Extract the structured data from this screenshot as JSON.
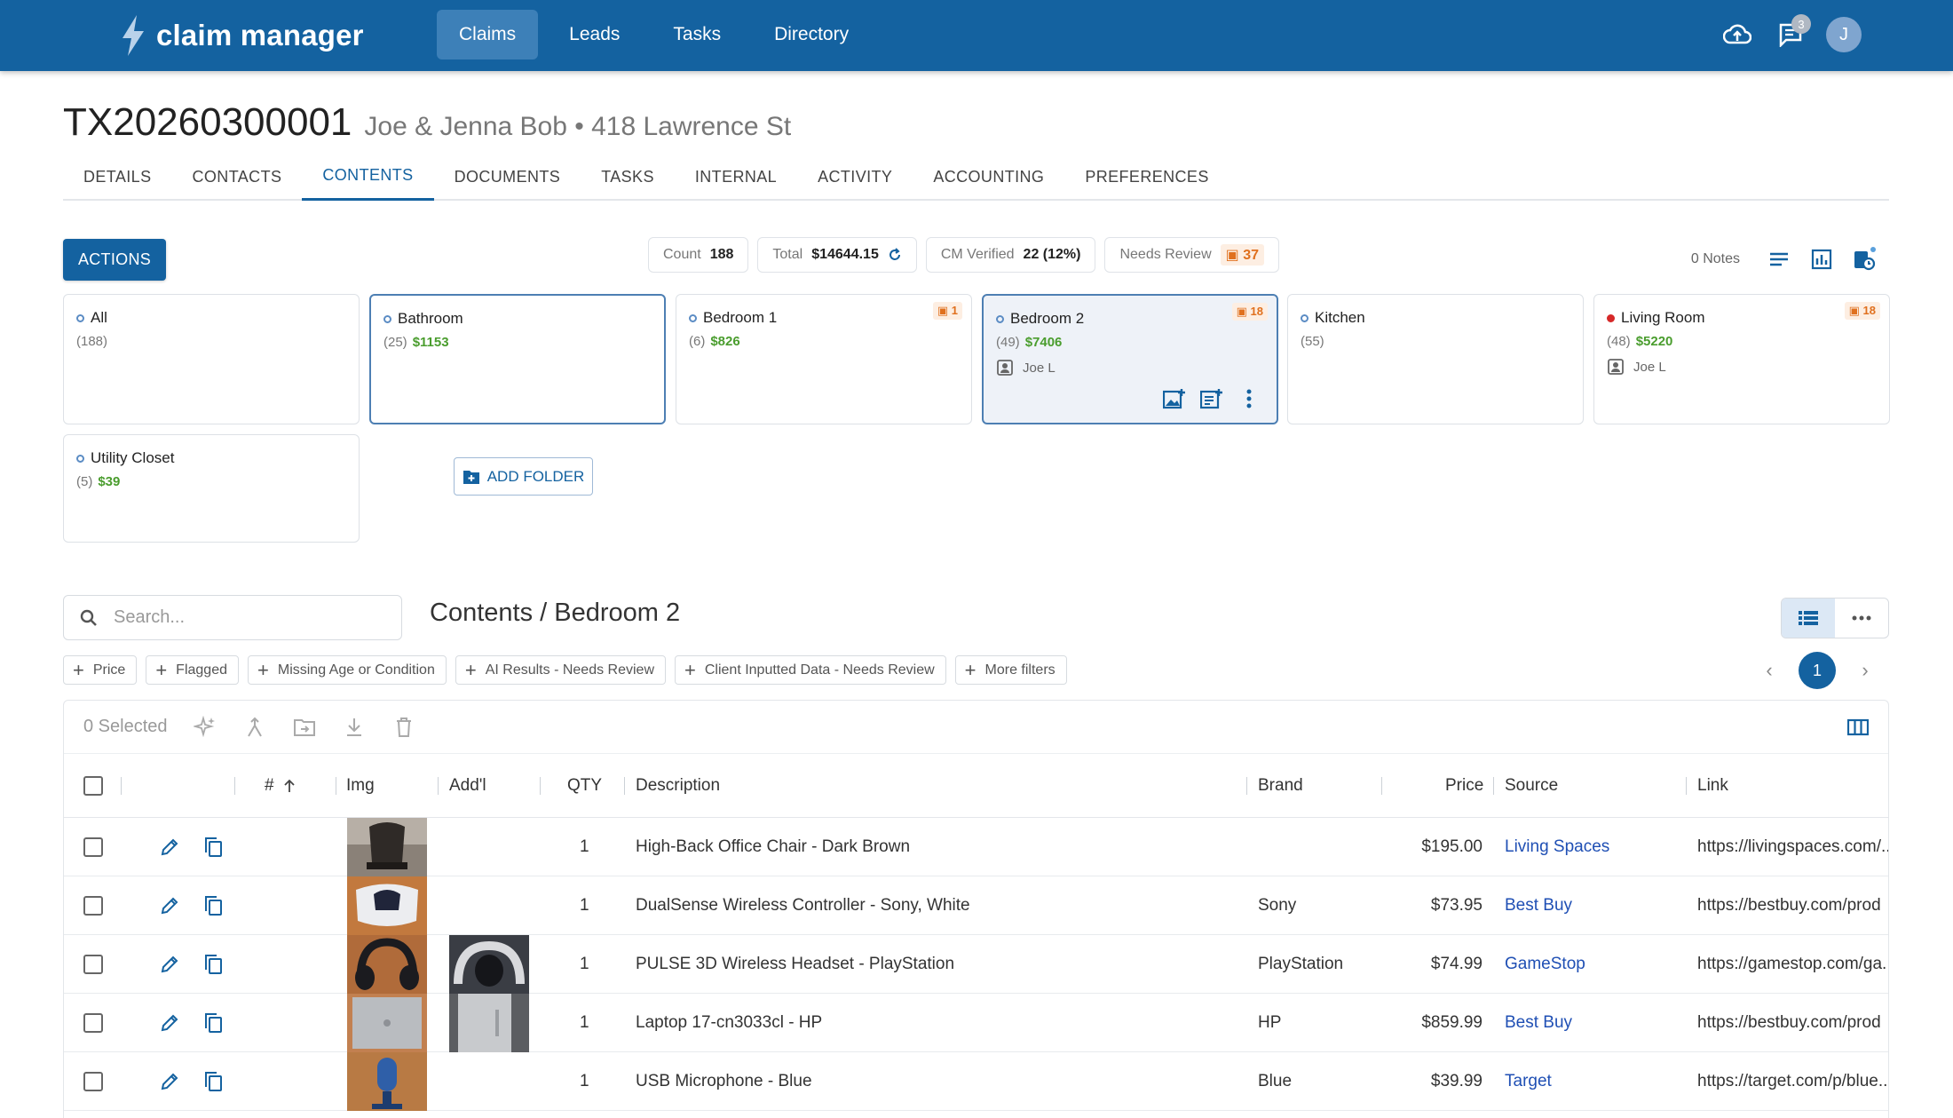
{
  "app": {
    "name": "claim manager",
    "nav": [
      "Claims",
      "Leads",
      "Tasks",
      "Directory"
    ],
    "notification_count": "3",
    "avatar_initial": "J",
    "accent": "#1462a0"
  },
  "claim": {
    "id": "TX20260300001",
    "subtitle": "Joe & Jenna Bob • 418 Lawrence St"
  },
  "tabs": [
    "DETAILS",
    "CONTACTS",
    "CONTENTS",
    "DOCUMENTS",
    "TASKS",
    "INTERNAL",
    "ACTIVITY",
    "ACCOUNTING",
    "PREFERENCES"
  ],
  "actions_label": "ACTIONS",
  "stats": {
    "count_label": "Count",
    "count_value": "188",
    "total_label": "Total",
    "total_value": "$14644.15",
    "verified_label": "CM Verified",
    "verified_value": "22 (12%)",
    "review_label": "Needs Review",
    "review_value": "37"
  },
  "notes_label": "0 Notes",
  "folders": [
    {
      "name": "All",
      "count": "(188)",
      "amount": "",
      "user": "",
      "flag": ""
    },
    {
      "name": "Bathroom",
      "count": "(25)",
      "amount": "$1153",
      "user": "",
      "flag": ""
    },
    {
      "name": "Bedroom 1",
      "count": "(6)",
      "amount": "$826",
      "user": "",
      "flag": "1"
    },
    {
      "name": "Bedroom 2",
      "count": "(49)",
      "amount": "$7406",
      "user": "Joe L",
      "flag": "18"
    },
    {
      "name": "Kitchen",
      "count": "(55)",
      "amount": "",
      "user": "",
      "flag": ""
    },
    {
      "name": "Living Room",
      "count": "(48)",
      "amount": "$5220",
      "user": "Joe L",
      "flag": "18"
    },
    {
      "name": "Utility Closet",
      "count": "(5)",
      "amount": "$39",
      "user": "",
      "flag": ""
    }
  ],
  "add_folder_label": "ADD FOLDER",
  "search": {
    "placeholder": "Search..."
  },
  "contents_title": "Contents / Bedroom 2",
  "filters": [
    "Price",
    "Flagged",
    "Missing Age or Condition",
    "AI Results - Needs Review",
    "Client Inputted Data - Needs Review",
    "More filters"
  ],
  "page": "1",
  "selected_label": "0 Selected",
  "columns": {
    "num": "#",
    "img": "Img",
    "addl": "Add'l",
    "qty": "QTY",
    "description": "Description",
    "brand": "Brand",
    "price": "Price",
    "source": "Source",
    "link": "Link"
  },
  "rows": [
    {
      "qty": "1",
      "description": "High-Back Office Chair - Dark Brown",
      "brand": "",
      "price": "$195.00",
      "source": "Living Spaces",
      "link": "https://livingspaces.com/..."
    },
    {
      "qty": "1",
      "description": "DualSense Wireless Controller - Sony, White",
      "brand": "Sony",
      "price": "$73.95",
      "source": "Best Buy",
      "link": "https://bestbuy.com/prod"
    },
    {
      "qty": "1",
      "description": "PULSE 3D Wireless Headset - PlayStation",
      "brand": "PlayStation",
      "price": "$74.99",
      "source": "GameStop",
      "link": "https://gamestop.com/ga..."
    },
    {
      "qty": "1",
      "description": "Laptop 17-cn3033cl - HP",
      "brand": "HP",
      "price": "$859.99",
      "source": "Best Buy",
      "link": "https://bestbuy.com/prod"
    },
    {
      "qty": "1",
      "description": "USB Microphone - Blue",
      "brand": "Blue",
      "price": "$39.99",
      "source": "Target",
      "link": "https://target.com/p/blue..."
    }
  ]
}
